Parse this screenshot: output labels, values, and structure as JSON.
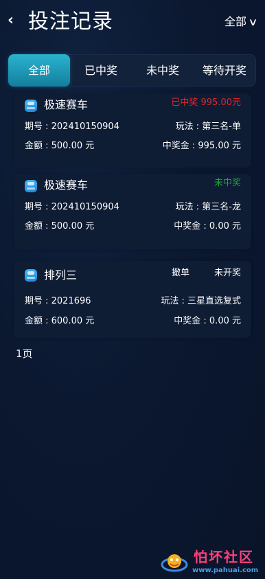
{
  "header": {
    "back_label": "‹",
    "title": "投注记录",
    "filter_label": "全部",
    "filter_icon": "chevron-down-icon"
  },
  "tabs": [
    {
      "label": "全部",
      "active": true
    },
    {
      "label": "已中奖",
      "active": false
    },
    {
      "label": "未中奖",
      "active": false
    },
    {
      "label": "等待开奖",
      "active": false
    }
  ],
  "records": [
    {
      "game": "极速赛车",
      "status": "已中奖 995.00元",
      "status_color": "#e8232b",
      "action": "",
      "period": "期号 : 202410150904",
      "play": "玩法 : 第三名-单",
      "amount": "金额 : 500.00 元",
      "prize": "中奖金 : 995.00 元"
    },
    {
      "game": "极速赛车",
      "status": "未中奖",
      "status_color": "#1fa33a",
      "action": "",
      "period": "期号 : 202410150904",
      "play": "玩法 : 第三名-龙",
      "amount": "金额 : 500.00 元",
      "prize": "中奖金 : 0.00 元"
    },
    {
      "game": "排列三",
      "status": "未开奖",
      "status_color": "#ffffff",
      "action": "撤单",
      "period": "期号 : 2021696",
      "play": "玩法 : 三星直选复式",
      "amount": "金额 : 600.00 元",
      "prize": "中奖金 : 0.00 元"
    }
  ],
  "pager": {
    "label": "1页"
  },
  "watermark": {
    "text": "怕坏社区",
    "url": "www.pahuai.com"
  }
}
